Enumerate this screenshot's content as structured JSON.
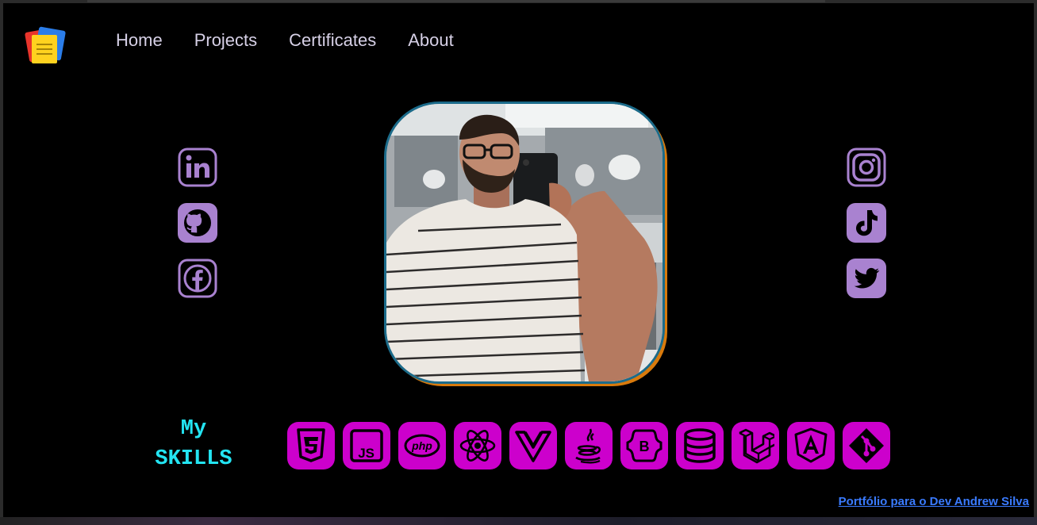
{
  "nav": {
    "items": [
      {
        "label": "Home"
      },
      {
        "label": "Projects"
      },
      {
        "label": "Certificates"
      },
      {
        "label": "About"
      }
    ]
  },
  "social_left": [
    {
      "icon": "linkedin-icon"
    },
    {
      "icon": "github-icon"
    },
    {
      "icon": "facebook-icon"
    }
  ],
  "social_right": [
    {
      "icon": "instagram-icon"
    },
    {
      "icon": "tiktok-icon"
    },
    {
      "icon": "twitter-icon"
    }
  ],
  "skills": {
    "title_line1": "My",
    "title_line2": "SKILLS",
    "icons": [
      "css3-icon",
      "javascript-icon",
      "php-icon",
      "react-icon",
      "vue-icon",
      "java-icon",
      "bootstrap-icon",
      "database-icon",
      "laravel-icon",
      "angular-icon",
      "git-icon"
    ],
    "js_text": "JS",
    "php_text": "php",
    "bootstrap_text": "B"
  },
  "footer": {
    "credit": "Portfólio para o Dev Andrew Silva"
  },
  "colors": {
    "social": "#a982d0",
    "skill_bg": "#cc00cc",
    "skills_title": "#23e4f2",
    "link": "#3a7bff"
  }
}
